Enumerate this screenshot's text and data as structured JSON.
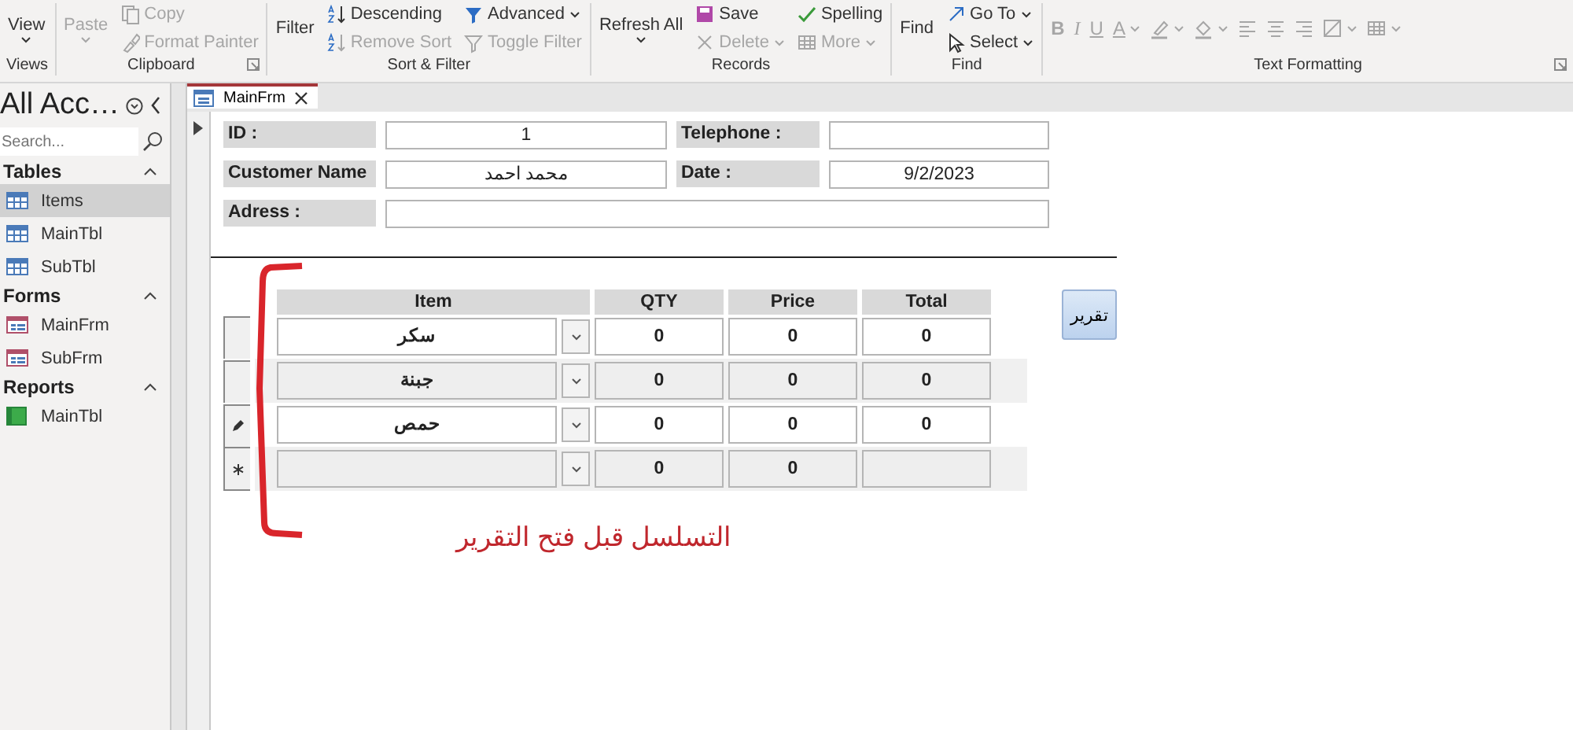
{
  "ribbon": {
    "groups": [
      {
        "label": "Views",
        "launcher": false,
        "columns": [
          [
            {
              "label": "View",
              "kind": "large",
              "dropdown": true,
              "disabled": false
            }
          ]
        ]
      },
      {
        "label": "Clipboard",
        "launcher": true,
        "columns": [
          [
            {
              "label": "Paste",
              "kind": "large",
              "dropdown": true,
              "disabled": true
            }
          ],
          [
            {
              "label": "Copy",
              "kind": "copy",
              "dropdown": false,
              "disabled": true
            },
            {
              "label": "Format Painter",
              "kind": "brush",
              "dropdown": false,
              "disabled": true
            }
          ]
        ]
      },
      {
        "label": "Sort & Filter",
        "launcher": false,
        "columns": [
          [
            {
              "label": "Filter",
              "kind": "large",
              "dropdown": false,
              "disabled": false
            }
          ],
          [
            {
              "label": "Descending",
              "kind": "sort",
              "dropdown": false,
              "disabled": false
            },
            {
              "label": "Remove Sort",
              "kind": "sort",
              "dropdown": false,
              "disabled": true
            }
          ],
          [
            {
              "label": "Advanced",
              "kind": "advanced",
              "dropdown": true,
              "disabled": false
            },
            {
              "label": "Toggle Filter",
              "kind": "funnel",
              "dropdown": false,
              "disabled": true
            }
          ]
        ]
      },
      {
        "label": "Records",
        "launcher": false,
        "columns": [
          [
            {
              "label": "Refresh All",
              "kind": "large",
              "dropdown": true,
              "disabled": false
            }
          ],
          [
            {
              "label": "Save",
              "kind": "save",
              "dropdown": false,
              "disabled": false
            },
            {
              "label": "Delete",
              "kind": "delete",
              "dropdown": true,
              "disabled": true
            }
          ],
          [
            {
              "label": "Spelling",
              "kind": "spelling",
              "dropdown": false,
              "disabled": false
            },
            {
              "label": "More",
              "kind": "grid",
              "dropdown": true,
              "disabled": true
            }
          ]
        ]
      },
      {
        "label": "Find",
        "launcher": false,
        "columns": [
          [
            {
              "label": "Find",
              "kind": "large",
              "dropdown": false,
              "disabled": false
            }
          ],
          [
            {
              "label": "Go To",
              "kind": "goto",
              "dropdown": true,
              "disabled": false
            },
            {
              "label": "Select",
              "kind": "select",
              "dropdown": true,
              "disabled": false
            }
          ]
        ]
      },
      {
        "label": "Text Formatting",
        "launcher": true,
        "columns": [
          [
            {
              "label": "B",
              "kind": "bold",
              "dropdown": false,
              "disabled": true
            },
            {
              "label": "I",
              "kind": "italic",
              "dropdown": false,
              "disabled": true
            },
            {
              "label": "U",
              "kind": "underline",
              "dropdown": false,
              "disabled": true
            },
            {
              "label": "A",
              "kind": "fontcolor",
              "dropdown": true,
              "disabled": true
            },
            {
              "kind": "highlighter",
              "dropdown": true,
              "disabled": true
            },
            {
              "kind": "fill",
              "dropdown": true,
              "disabled": true
            },
            {
              "kind": "align-left",
              "dropdown": false,
              "disabled": true
            },
            {
              "kind": "align-center",
              "dropdown": false,
              "disabled": true
            },
            {
              "kind": "align-right",
              "dropdown": false,
              "disabled": true
            },
            {
              "kind": "altfill",
              "dropdown": true,
              "disabled": true
            },
            {
              "kind": "grid",
              "dropdown": true,
              "disabled": true
            }
          ]
        ]
      }
    ]
  },
  "nav_pane": {
    "title": "All Acc…",
    "search": {
      "placeholder": "Search..."
    },
    "sections": [
      {
        "label": "Tables",
        "expanded": true,
        "items": [
          {
            "label": "Items",
            "kind": "table",
            "selected": true
          },
          {
            "label": "MainTbl",
            "kind": "table",
            "selected": false
          },
          {
            "label": "SubTbl",
            "kind": "table",
            "selected": false
          }
        ]
      },
      {
        "label": "Forms",
        "expanded": true,
        "items": [
          {
            "label": "MainFrm",
            "kind": "form",
            "selected": false
          },
          {
            "label": "SubFrm",
            "kind": "form",
            "selected": false
          }
        ]
      },
      {
        "label": "Reports",
        "expanded": true,
        "items": [
          {
            "label": "MainTbl",
            "kind": "report",
            "selected": false
          }
        ]
      }
    ]
  },
  "document": {
    "tab": {
      "label": "MainFrm"
    },
    "fields": [
      {
        "label": "ID :",
        "value": "1"
      },
      {
        "label": "Telephone :"
      },
      {
        "label": "Customer Name",
        "value": "محمد احمد"
      },
      {
        "label": "Date :",
        "value": "9/2/2023"
      },
      {
        "label": "Adress :",
        "wide": true
      }
    ],
    "subform": {
      "columns": [
        "Item",
        "QTY",
        "Price",
        "Total"
      ],
      "rows": [
        {
          "kind": "saved",
          "item": "سكر",
          "qty": "0",
          "price": "0",
          "total": "0"
        },
        {
          "kind": "saved",
          "item": "جبنة",
          "qty": "0",
          "price": "0",
          "total": "0"
        },
        {
          "kind": "editing",
          "item": "حمص",
          "qty": "0",
          "price": "0",
          "total": "0"
        },
        {
          "kind": "new",
          "qty": "0",
          "price": "0"
        }
      ]
    },
    "button": "تقرير",
    "annotation": "التسلسل قبل فتح التقرير"
  }
}
